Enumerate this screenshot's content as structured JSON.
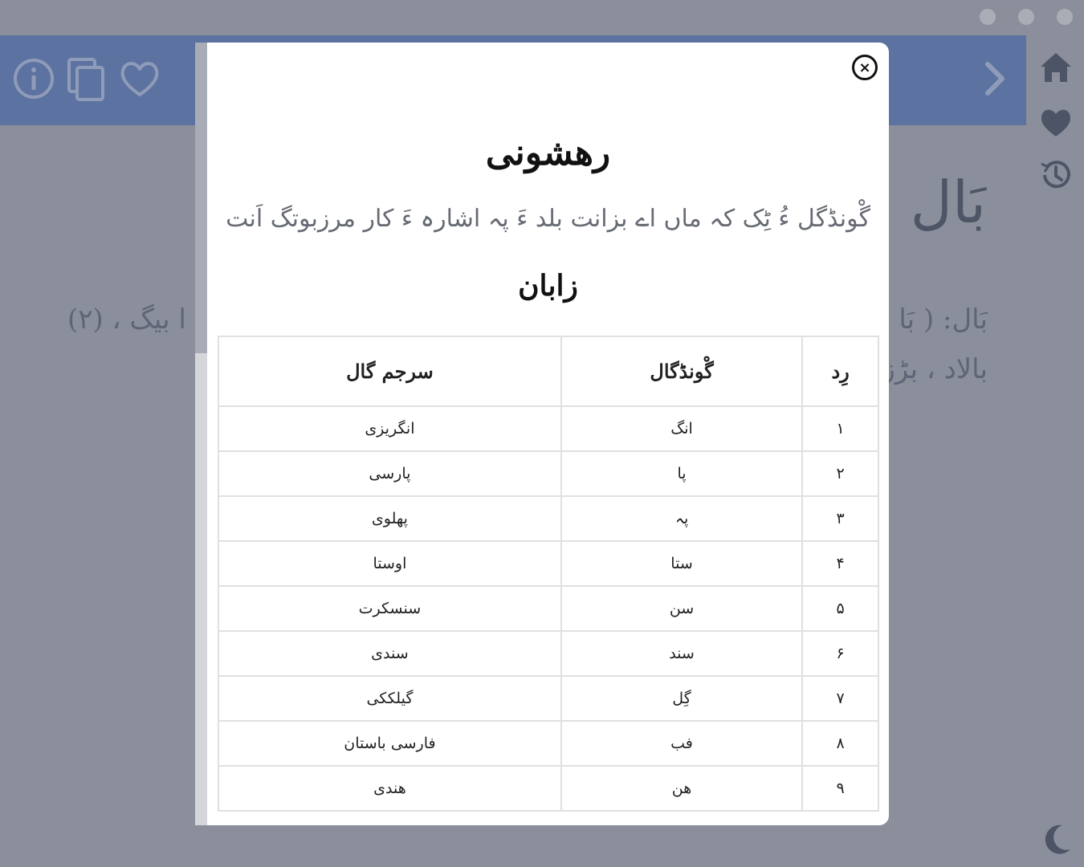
{
  "window": {
    "dots": [
      "dot",
      "dot",
      "dot"
    ]
  },
  "toolbar": {
    "icons": [
      "info-icon",
      "copy-icon",
      "heart-outline-icon",
      "chevron-right-icon"
    ]
  },
  "rail": {
    "icons": [
      "home-icon",
      "heart-icon",
      "history-icon",
      "moon-icon"
    ]
  },
  "background": {
    "word": "بَال",
    "line1_right": "بَال: ( بَا",
    "line1_left": "ا بیگ ، (۲)",
    "line2_right": "بالاد ، بڑز"
  },
  "modal": {
    "close_label": "×",
    "title": "رهشونی",
    "subtitle": "گْونڈگل ءُ ٹِک کہ ماں اے بزانت بلد ءَ پہ اشارہ ءَ کار مرزبوتگ اَنت",
    "section_heading": "زابان",
    "table": {
      "headers": [
        "رِد",
        "گْونڈگال",
        "سرجم گال"
      ],
      "rows": [
        [
          "۱",
          "انگ",
          "انگریزی"
        ],
        [
          "۲",
          "پا",
          "پارسی"
        ],
        [
          "۳",
          "پہ",
          "پهلوی"
        ],
        [
          "۴",
          "ستا",
          "اوستا"
        ],
        [
          "۵",
          "سن",
          "سنسکرت"
        ],
        [
          "۶",
          "سند",
          "سندی"
        ],
        [
          "۷",
          "گِل",
          "گیلککی"
        ],
        [
          "۸",
          "فب",
          "فارسی باستان"
        ],
        [
          "۹",
          "هن",
          "هندی"
        ]
      ]
    }
  }
}
